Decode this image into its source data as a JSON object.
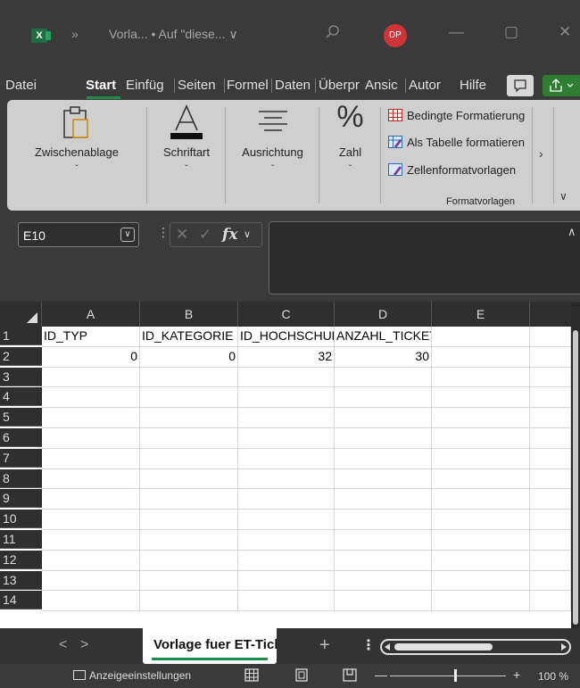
{
  "titlebar": {
    "app_icon_letter": "X",
    "more_glyph": "»",
    "title": "Vorla... • Auf \"diese... ∨",
    "user_initials": "DP",
    "minimize": "—",
    "maximize": "▢",
    "close": "✕"
  },
  "menu": {
    "tabs": [
      "Datei",
      "Start",
      "Einfüg",
      "Seiten",
      "Formel",
      "Daten",
      "Überpr",
      "Ansic",
      "Autor",
      "Hilfe"
    ],
    "active_tab": "Start"
  },
  "ribbon": {
    "clipboard": "Zwischenablage",
    "font": "Schriftart",
    "alignment": "Ausrichtung",
    "number": "Zahl",
    "conditional_formatting": "Bedingte Formatierung",
    "format_as_table": "Als Tabelle formatieren",
    "cell_styles": "Zellenformatvorlagen",
    "styles_group": "Formatvorlagen",
    "expand_glyph": "›",
    "collapse_glyph": "∨",
    "dropdown_glyph": "ˇ"
  },
  "formula_bar": {
    "name_box": "E10",
    "cancel": "✕",
    "enter": "✓",
    "fx": "fx",
    "fx_dropdown": "∨",
    "formula": ""
  },
  "grid": {
    "columns": [
      "A",
      "B",
      "C",
      "D",
      "E"
    ],
    "rows": [
      {
        "num": "1",
        "cells": [
          "ID_TYP",
          "ID_KATEGORIE",
          "ID_HOCHSCHULE",
          "ANZAHL_TICKETS",
          ""
        ]
      },
      {
        "num": "2",
        "cells": [
          "0",
          "0",
          "32",
          "30",
          ""
        ]
      },
      {
        "num": "3",
        "cells": [
          "",
          "",
          "",
          "",
          ""
        ]
      },
      {
        "num": "4",
        "cells": [
          "",
          "",
          "",
          "",
          ""
        ]
      },
      {
        "num": "5",
        "cells": [
          "",
          "",
          "",
          "",
          ""
        ]
      },
      {
        "num": "6",
        "cells": [
          "",
          "",
          "",
          "",
          ""
        ]
      },
      {
        "num": "7",
        "cells": [
          "",
          "",
          "",
          "",
          ""
        ]
      },
      {
        "num": "8",
        "cells": [
          "",
          "",
          "",
          "",
          ""
        ]
      },
      {
        "num": "9",
        "cells": [
          "",
          "",
          "",
          "",
          ""
        ]
      },
      {
        "num": "10",
        "cells": [
          "",
          "",
          "",
          "",
          ""
        ]
      },
      {
        "num": "11",
        "cells": [
          "",
          "",
          "",
          "",
          ""
        ]
      },
      {
        "num": "12",
        "cells": [
          "",
          "",
          "",
          "",
          ""
        ]
      },
      {
        "num": "13",
        "cells": [
          "",
          "",
          "",
          "",
          ""
        ]
      },
      {
        "num": "14",
        "cells": [
          "",
          "",
          "",
          "",
          ""
        ]
      }
    ]
  },
  "sheets": {
    "prev": "<",
    "next": ">",
    "active": "Vorlage fuer ET-Tickets",
    "add": "+",
    "more": "⋮"
  },
  "status": {
    "display_settings": "Anzeigeeinstellungen",
    "zoom_minus": "—",
    "zoom_plus": "+",
    "zoom_level": "100 %"
  },
  "colors": {
    "accent_green": "#1d8a4b",
    "title_bg": "#3a3a3a",
    "ribbon_bg": "#cfcfcf",
    "avatar_red": "#d13438"
  }
}
